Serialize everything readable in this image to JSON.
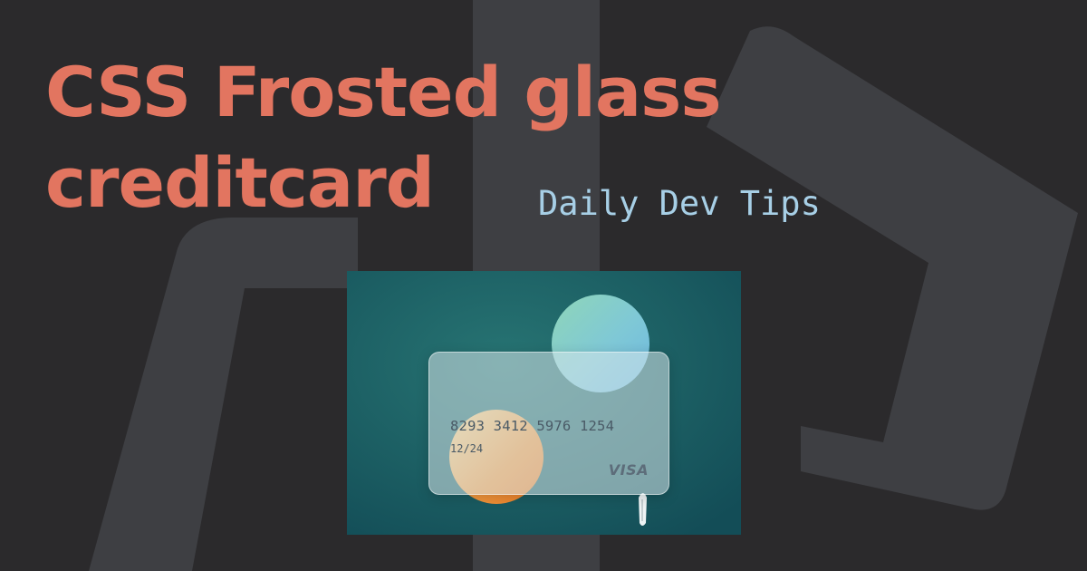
{
  "title": {
    "line1": "CSS Frosted glass",
    "line2": "creditcard"
  },
  "tagline": "Daily Dev Tips",
  "card": {
    "number": "8293 3412 5976 1254",
    "expiry": "12/24",
    "brand": "VISA"
  },
  "colors": {
    "background": "#2b2a2c",
    "shapes": "#3e3f43",
    "title": "#e27560",
    "tagline": "#a7cfe6",
    "ocean": "#1c5f63"
  },
  "icons": {
    "background_logo": "daily-dev-tips-logo-icon",
    "boat": "boat-icon"
  }
}
